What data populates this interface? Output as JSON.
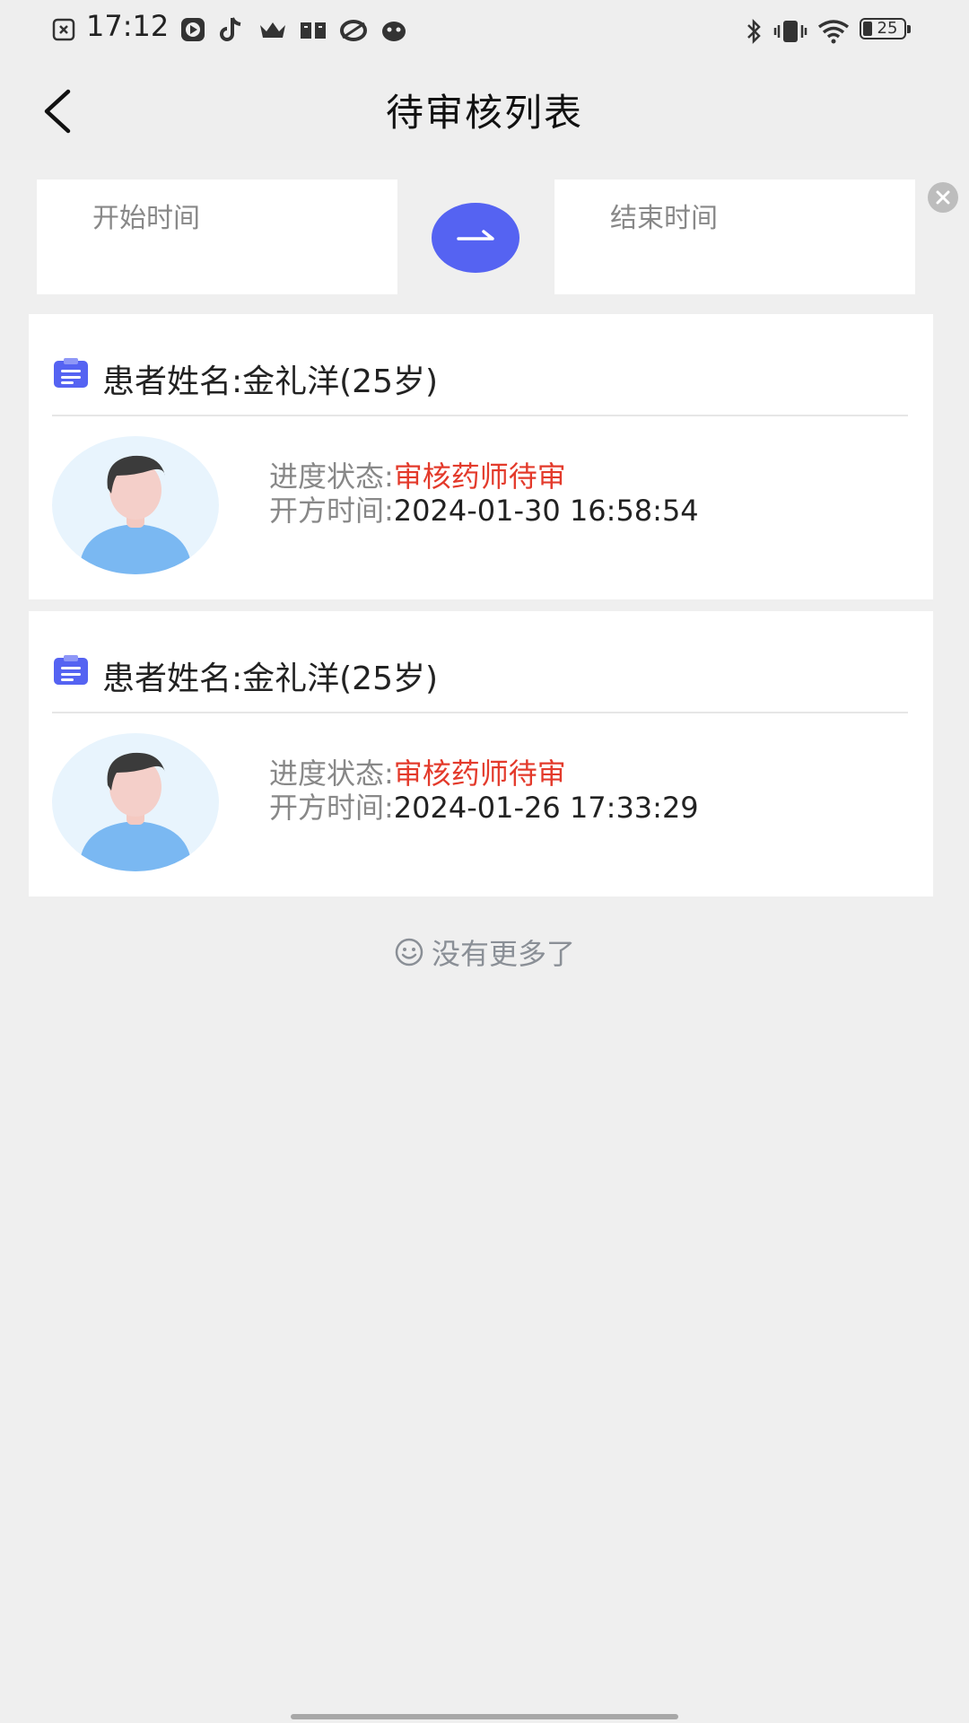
{
  "status_bar": {
    "time": "17:12",
    "battery": "25",
    "left_icons": [
      "notification-x-icon",
      "video-play-icon",
      "tiktok-icon",
      "crown-icon",
      "book-icon",
      "app-ring-icon",
      "bird-icon"
    ],
    "right_icons": [
      "bluetooth-icon",
      "vibrate-icon",
      "wifi-icon",
      "battery-icon"
    ]
  },
  "header": {
    "title": "待审核列表"
  },
  "filter": {
    "start_placeholder": "开始时间",
    "end_placeholder": "结束时间",
    "accent_color": "#5563f2"
  },
  "records": [
    {
      "patient": "患者姓名:金礼洋(25岁)",
      "status_label": "进度状态:",
      "status_value": "审核药师待审",
      "time_label": "开方时间:",
      "time_value": "2024-01-30 16:58:54"
    },
    {
      "patient": "患者姓名:金礼洋(25岁)",
      "status_label": "进度状态:",
      "status_value": "审核药师待审",
      "time_label": "开方时间:",
      "time_value": "2024-01-26 17:33:29"
    }
  ],
  "footer": {
    "no_more": "没有更多了"
  },
  "colors": {
    "status_red": "#e33a2b",
    "icon_blue": "#5563f2",
    "avatar_bg": "#e8f4fd",
    "shirt_blue": "#7ab8f2"
  }
}
